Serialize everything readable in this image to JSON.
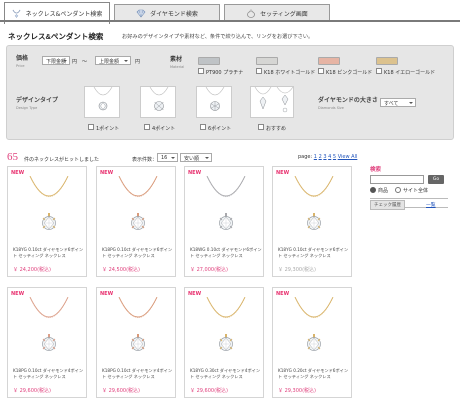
{
  "tabs": [
    {
      "label": "ネックレス&ペンダント検索",
      "icon": "necklace-icon",
      "active": true
    },
    {
      "label": "ダイヤモンド検索",
      "icon": "diamond-icon",
      "active": false
    },
    {
      "label": "セッティング画面",
      "icon": "setting-icon",
      "active": false
    }
  ],
  "header": {
    "title": "ネックレス&ペンダント検索",
    "intro": "お好みのデザインタイプや素材など、条件で絞り込んで、リングをお選び下さい。"
  },
  "search": {
    "price": {
      "label": "価格",
      "sublabel": "Price",
      "min_value": "下限金額",
      "max_value": "上限金額",
      "unit": "円",
      "tilde": "〜"
    },
    "material": {
      "label": "素材",
      "sublabel": "Material",
      "options": [
        {
          "label": "PT900 プラチナ",
          "color": "#bfc3c6"
        },
        {
          "label": "K18 ホワイトゴールド",
          "color": "#d6d6d4"
        },
        {
          "label": "K18 ピンクゴールド",
          "color": "#e6b4a4"
        },
        {
          "label": "K18 イエローゴールド",
          "color": "#dcc28e"
        }
      ]
    },
    "design": {
      "label": "デザインタイプ",
      "sublabel": "Design Type",
      "options": [
        "1ポイント",
        "4ポイント",
        "6ポイント",
        "おすすめ"
      ]
    },
    "size": {
      "label": "ダイヤモンドの大きさ",
      "sublabel": "Diamonds Size",
      "value": "すべて"
    }
  },
  "results": {
    "count": "65",
    "count_text": "件のネックレスがヒットしました",
    "per_page_label": "表示件数：",
    "per_page_value": "16",
    "sort_value": "安い順",
    "page_label": "page:",
    "pages": [
      "1",
      "2",
      "3",
      "4",
      "5"
    ],
    "view_all": "View All"
  },
  "products": [
    {
      "new": "NEW",
      "name": "K18YG 0.10ct ダイヤモンド6ポイント セッティング ネックレス",
      "price": "￥ 24,200(税込)",
      "chain": "#d9b46a",
      "grey": false
    },
    {
      "new": "NEW",
      "name": "K18PG 0.10ct ダイヤモンド6ポイント セッティング ネックレス",
      "price": "￥ 24,500(税込)",
      "chain": "#d99a7a",
      "grey": false
    },
    {
      "new": "NEW",
      "name": "K18WG 0.10ct ダイヤモンド6ポイント セッティング ネックレス",
      "price": "￥ 27,000(税込)",
      "chain": "#a9a9ad",
      "grey": false
    },
    {
      "new": "NEW",
      "name": "K18YG 0.10ct ダイヤモンド6ポイント セッティング ネックレス",
      "price": "￥ 29,300(税込)",
      "chain": "#d9b46a",
      "grey": true
    },
    {
      "new": "NEW",
      "name": "K18PG 0.10ct ダイヤモンド4ポイント セッティング ネックレス",
      "price": "￥ 29,600(税込)",
      "chain": "#dca08a",
      "grey": false
    },
    {
      "new": "NEW",
      "name": "K18PG 0.10ct ダイヤモンド4ポイント セッティング ネックレス",
      "price": "￥ 29,600(税込)",
      "chain": "#d99a7a",
      "grey": false
    },
    {
      "new": "NEW",
      "name": "K18YG 0.30ct ダイヤモンド4ポイント セッティング ネックレス",
      "price": "￥ 29,600(税込)",
      "chain": "#d9b46a",
      "grey": false
    },
    {
      "new": "NEW",
      "name": "K18YG 0.20ct ダイヤモンド6ポイント セッティング ネックレス",
      "price": "￥ 29,300(税込)",
      "chain": "#d9b46a",
      "grey": false
    }
  ],
  "sidebar": {
    "search_title": "検索",
    "search_button": "Go",
    "scope_options": [
      "商品",
      "サイト全体"
    ],
    "history_label": "チェック履歴",
    "history_link": "一覧"
  },
  "colors": {
    "accent": "#e0427e",
    "link": "#2255bb",
    "panel": "#e6e6e6"
  }
}
